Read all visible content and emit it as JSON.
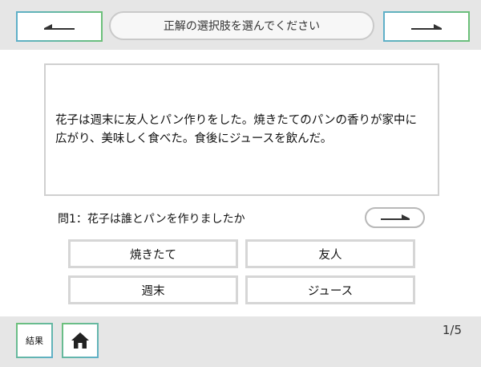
{
  "header": {
    "instruction": "正解の選択肢を選んでください",
    "prev_icon": "arrow-left-icon",
    "next_icon": "arrow-right-icon"
  },
  "passage": {
    "text": "花子は週末に友人とパン作りをした。焼きたてのパンの香りが家中に広がり、美味しく食べた。食後にジュースを飲んだ。"
  },
  "question": {
    "text": "問1：花子は誰とパンを作りましたか",
    "next_icon": "arrow-right-icon"
  },
  "choices": [
    "焼きたて",
    "友人",
    "週末",
    "ジュース"
  ],
  "footer": {
    "result_label": "結果",
    "home_icon": "home-icon",
    "page_counter": "1/5"
  },
  "colors": {
    "accent_green": "#6cc07a",
    "accent_blue": "#5fb0c8",
    "background": "#e6e6e6"
  }
}
